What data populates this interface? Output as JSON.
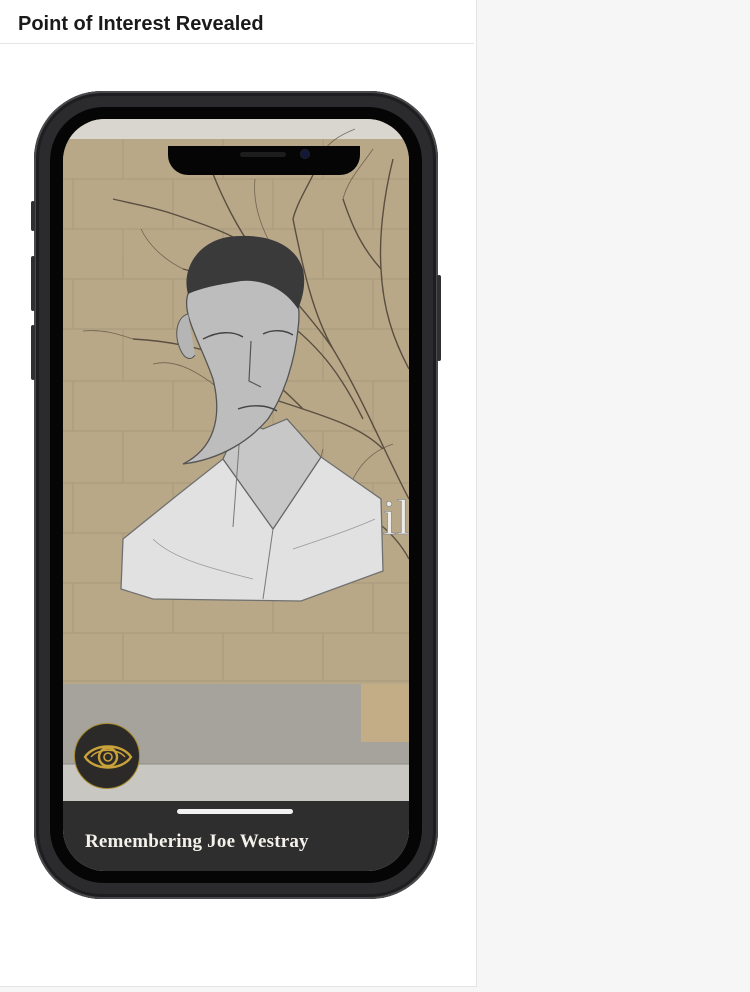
{
  "header": {
    "title": "Point of Interest Revealed"
  },
  "phone": {
    "wall_sign_text": "Mobile",
    "ar_button_icon": "eye-icon",
    "caption": "Remembering Joe Westray"
  },
  "colors": {
    "accent_gold": "#a88a2c",
    "caption_bar": "#2e2e2e",
    "wall": "#b9a98a"
  }
}
